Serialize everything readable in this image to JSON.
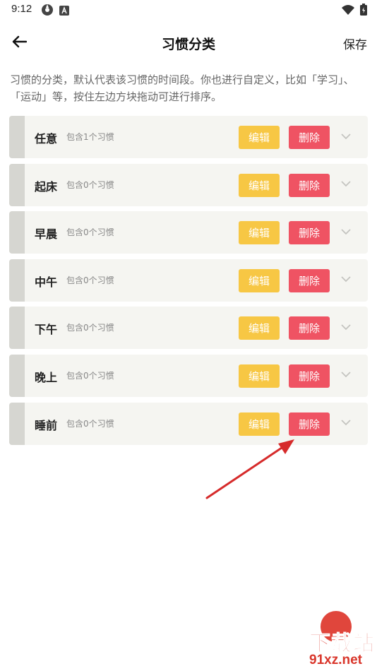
{
  "status_bar": {
    "time": "9:12",
    "left_icons": [
      "settings-sync-icon",
      "app-notification-icon"
    ],
    "right_icons": [
      "wifi-icon",
      "battery-icon"
    ]
  },
  "header": {
    "title": "习惯分类",
    "back_icon": "arrow-left-icon",
    "save_label": "保存"
  },
  "description": "习惯的分类，默认代表该习惯的时间段。你也进行自定义，比如「学习」、「运动」等，按住左边方块拖动可进行排序。",
  "categories": [
    {
      "name": "任意",
      "count": "包含1个习惯",
      "edit": "编辑",
      "delete": "删除"
    },
    {
      "name": "起床",
      "count": "包含0个习惯",
      "edit": "编辑",
      "delete": "删除"
    },
    {
      "name": "早晨",
      "count": "包含0个习惯",
      "edit": "编辑",
      "delete": "删除"
    },
    {
      "name": "中午",
      "count": "包含0个习惯",
      "edit": "编辑",
      "delete": "删除"
    },
    {
      "name": "下午",
      "count": "包含0个习惯",
      "edit": "编辑",
      "delete": "删除"
    },
    {
      "name": "晚上",
      "count": "包含0个习惯",
      "edit": "编辑",
      "delete": "删除"
    },
    {
      "name": "睡前",
      "count": "包含0个习惯",
      "edit": "编辑",
      "delete": "删除"
    }
  ],
  "colors": {
    "edit_button": "#f7c744",
    "delete_button": "#ef5363",
    "row_background": "#f5f5f1",
    "drag_handle": "#d6d6d1",
    "annotation_arrow": "#d62b2b"
  },
  "watermark": {
    "line1": "下载站",
    "line2": "91xz.net"
  }
}
